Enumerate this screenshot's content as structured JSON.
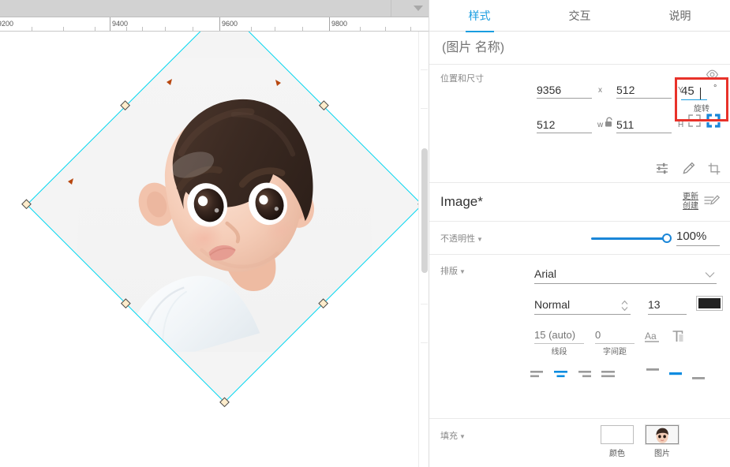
{
  "canvas": {
    "ruler": {
      "unit_labels": [
        "9200",
        "9400",
        "9600",
        "9800"
      ],
      "minor_tick_count": 5
    },
    "selection": {
      "shape": "diamond",
      "rotation_deg": 45,
      "outline_color": "#00d7f0",
      "handle_fill": "#ffeccb",
      "handle_border": "#4a4a4a",
      "image_background": "#f4f4f4",
      "handles": [
        "nw",
        "n",
        "ne",
        "w",
        "e",
        "sw",
        "s",
        "se"
      ]
    },
    "artwork": {
      "alt": "3D cartoon avatar of a boy with dark brown hair and white shirt",
      "hair_color": "#3a2a22",
      "skin_color": "#f6d3c0",
      "shirt_color": "#f2f5f7"
    }
  },
  "panel": {
    "tabs": [
      {
        "label": "样式",
        "active": true
      },
      {
        "label": "交互",
        "active": false
      },
      {
        "label": "说明",
        "active": false
      }
    ],
    "name_placeholder": "(图片 名称)",
    "name_value": "",
    "position_size": {
      "title": "位置和尺寸",
      "eye_icon": "eye-icon",
      "x": {
        "value": "9356",
        "suffix": "x"
      },
      "y": {
        "value": "512",
        "suffix": "Y"
      },
      "w": {
        "value": "512",
        "suffix": "w"
      },
      "h": {
        "value": "511",
        "suffix": "H"
      },
      "lock_icon": "unlock-icon",
      "rotation": {
        "value": "45",
        "degree_symbol": "°",
        "label": "旋转",
        "highlight_color": "#e8322a",
        "focused": true
      },
      "resize_icons": [
        "fit-icon",
        "fill-icon"
      ],
      "tool_icons": [
        "adjust-sliders-icon",
        "pencil-icon",
        "crop-icon"
      ]
    },
    "image_section": {
      "name": "Image*",
      "update_create_label_line1": "更新",
      "update_create_label_line2": "创建",
      "edit_icon": "edit-document-icon"
    },
    "opacity": {
      "label": "不透明性",
      "value": "100%",
      "percent": 100,
      "accent": "#1a86d8"
    },
    "typography": {
      "label": "排版",
      "font_family": "Arial",
      "font_weight": "Normal",
      "font_size": "13",
      "color_hex": "#222222",
      "line_height": {
        "value": "",
        "placeholder": "15 (auto)",
        "label": "线段"
      },
      "letter_spacing": {
        "value": "",
        "placeholder": "0",
        "label": "字间距"
      },
      "case_icons": [
        "text-case-icon",
        "text-clear-format-icon"
      ],
      "align_horizontal": {
        "options": [
          "align-left-icon",
          "align-center-icon",
          "align-right-icon",
          "align-justify-icon"
        ],
        "active_index": 1
      },
      "align_vertical": {
        "options": [
          "align-top-icon",
          "align-middle-icon",
          "align-bottom-icon"
        ],
        "active_index": 1
      },
      "active_color": "#0b8ce0"
    },
    "fill": {
      "label": "填充",
      "options": [
        {
          "caption": "颜色",
          "type": "color",
          "selected": false
        },
        {
          "caption": "图片",
          "type": "image",
          "selected": true
        }
      ]
    }
  }
}
